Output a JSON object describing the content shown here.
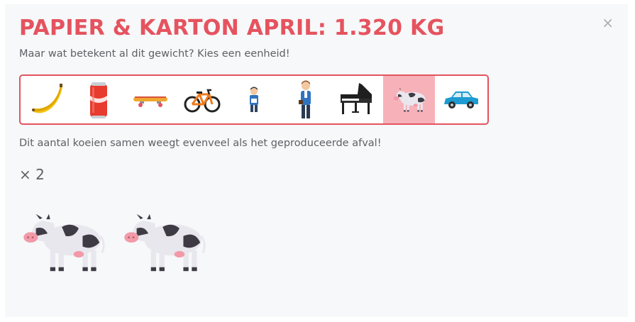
{
  "modal": {
    "title": "PAPIER & KARTON APRIL: 1.320 KG",
    "close_symbol": "×",
    "subtitle": "Maar wat betekent al dit gewicht? Kies een eenheid!",
    "description": "Dit aantal koeien samen weegt evenveel als het geproduceerde afval!",
    "multiplier": "× 2",
    "cow_count": 2
  },
  "units": [
    {
      "icon": "banana-icon",
      "selected": false
    },
    {
      "icon": "soda-can-icon",
      "selected": false
    },
    {
      "icon": "skateboard-icon",
      "selected": false
    },
    {
      "icon": "bicycle-icon",
      "selected": false
    },
    {
      "icon": "child-icon",
      "selected": false
    },
    {
      "icon": "man-icon",
      "selected": false
    },
    {
      "icon": "grand-piano-icon",
      "selected": false
    },
    {
      "icon": "cow-icon",
      "selected": true
    },
    {
      "icon": "car-icon",
      "selected": false
    }
  ],
  "colors": {
    "accent": "#e5535f",
    "selected_bg": "#f7b2b9",
    "panel_bg": "#f6f8f9",
    "text": "#5d6166"
  }
}
